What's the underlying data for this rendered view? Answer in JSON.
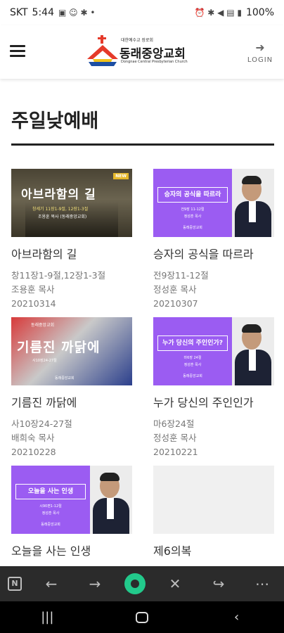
{
  "status_bar": {
    "carrier": "SKT",
    "time": "5:44",
    "battery": "100%"
  },
  "header": {
    "logo_top": "대한예수교 장로회",
    "logo_name": "동래중앙교회",
    "logo_sub": "Dongnae Central Presbyterian Church",
    "login_label": "LOGIN",
    "menu_icon": "hamburger-menu-icon",
    "login_icon": "login-icon"
  },
  "page": {
    "title": "주일낮예배"
  },
  "sermons": [
    {
      "title": "아브라함의 길",
      "scripture": "창11장1-9절,12장1-3절",
      "preacher": "조용훈 목사",
      "date": "20210314",
      "thumb": {
        "main": "아브라함의 길",
        "tag": "NEW",
        "line1": "창세기 11장1-9절, 12장1-3절",
        "line2": "조용훈 목사 (동래중앙교회)"
      }
    },
    {
      "title": "승자의 공식을 따르라",
      "scripture": "전9장11-12절",
      "preacher": "정성훈 목사",
      "date": "20210307",
      "thumb": {
        "main": "승자의 공식을 따르라",
        "line1": "전9장 11-12절",
        "line2": "정성훈 목사",
        "church": "동래중앙교회"
      }
    },
    {
      "title": "기름진 까닭에",
      "scripture": "사10장24-27절",
      "preacher": "배희숙 목사",
      "date": "20210228",
      "thumb": {
        "main": "기름진 까닭에",
        "tag": "동래중앙교회",
        "line1": "사10장24-27절",
        "church": "동래중앙교회"
      }
    },
    {
      "title": "누가 당신의 주인인가",
      "scripture": "마6장24절",
      "preacher": "정성훈 목사",
      "date": "20210221",
      "thumb": {
        "main": "누가 당신의 주인인가?",
        "line1": "마6장 24절",
        "line2": "정성훈 목사",
        "church": "동래중앙교회"
      }
    },
    {
      "title": "오늘을 사는 인생",
      "scripture": "",
      "preacher": "",
      "date": "",
      "thumb": {
        "main": "오늘을 사는 인생",
        "line1": "시90편1-12절",
        "line2": "정성훈 목사",
        "church": "동래중앙교회"
      }
    },
    {
      "title": "제6의복",
      "scripture": "",
      "preacher": "",
      "date": "",
      "thumb": {}
    }
  ],
  "toolbar": {
    "icons": [
      "naver-icon",
      "back-icon",
      "forward-icon",
      "green-dot-icon",
      "close-icon",
      "share-icon",
      "more-icon"
    ]
  },
  "navbar": {
    "icons": [
      "recent-apps-icon",
      "home-icon",
      "back-icon"
    ]
  },
  "colors": {
    "purple": "#9b5cf2",
    "toolbar_bg": "#2b2b2b",
    "green": "#22c98b"
  }
}
